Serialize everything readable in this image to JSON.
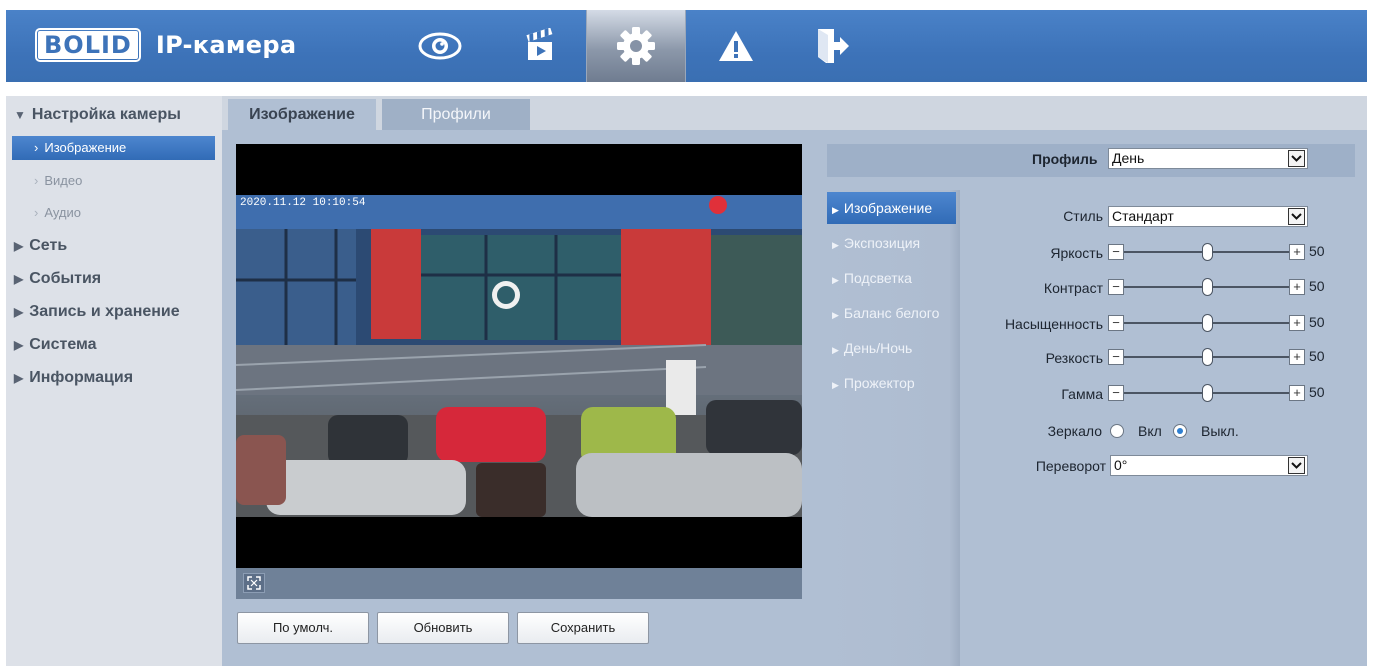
{
  "brand": {
    "logo": "BOLID",
    "title": "IP-камера"
  },
  "top_nav": [
    {
      "icon": "eye-icon",
      "label": ""
    },
    {
      "icon": "clapperboard-icon",
      "label": ""
    },
    {
      "icon": "gear-icon",
      "label": ""
    },
    {
      "icon": "warning-icon",
      "label": ""
    },
    {
      "icon": "logout-icon",
      "label": ""
    }
  ],
  "sidebar": {
    "camera_settings": "Настройка камеры",
    "image": "Изображение",
    "video": "Видео",
    "audio": "Аудио",
    "network": "Сеть",
    "events": "События",
    "storage": "Запись и хранение",
    "system": "Система",
    "info": "Информация"
  },
  "tabs": {
    "image": "Изображение",
    "profiles": "Профили"
  },
  "video": {
    "timestamp": "2020.11.12 10:10:54"
  },
  "buttons": {
    "default": "По умолч.",
    "refresh": "Обновить",
    "save": "Сохранить"
  },
  "profile": {
    "label": "Профиль",
    "value": "День"
  },
  "submenu": {
    "image": "Изображение",
    "exposure": "Экспозиция",
    "backlight": "Подсветка",
    "white_balance": "Баланс белого",
    "day_night": "День/Ночь",
    "illuminator": "Прожектор"
  },
  "settings": {
    "style_label": "Стиль",
    "style_value": "Стандарт",
    "brightness_label": "Яркость",
    "brightness": 50,
    "contrast_label": "Контраст",
    "contrast": 50,
    "saturation_label": "Насыщенность",
    "saturation": 50,
    "sharpness_label": "Резкость",
    "sharpness": 50,
    "gamma_label": "Гамма",
    "gamma": 50,
    "mirror_label": "Зеркало",
    "mirror_on": "Вкл",
    "mirror_off": "Выкл.",
    "mirror_selected": "off",
    "flip_label": "Переворот",
    "flip_value": "0°",
    "minus": "−",
    "plus": "+"
  },
  "colors": {
    "accent": "#316bb6",
    "header": "#3d73b9",
    "panel": "#b0bfd3"
  }
}
